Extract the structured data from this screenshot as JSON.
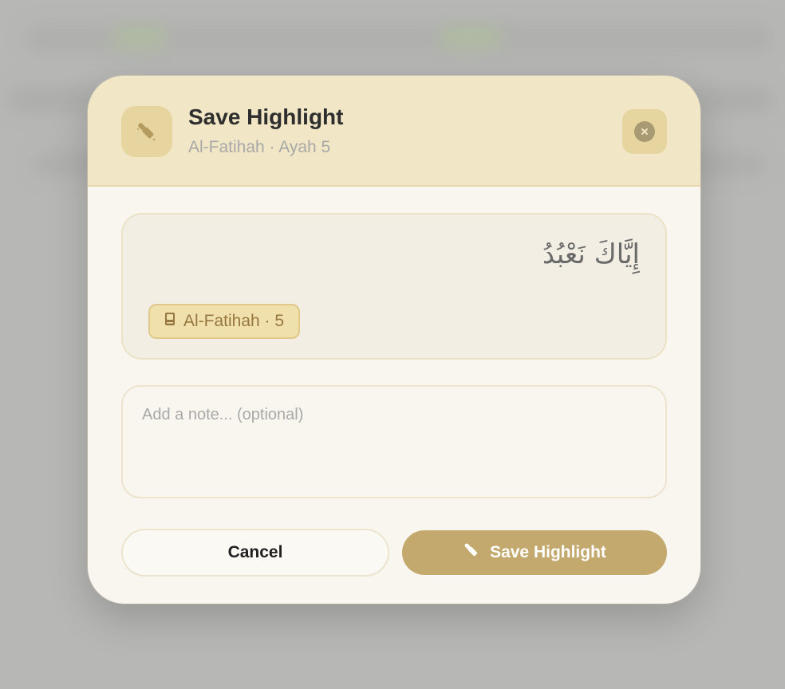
{
  "dialog": {
    "title": "Save Highlight",
    "subtitle": "Al-Fatihah · Ayah 5",
    "header_icon": "highlighter-icon",
    "close_icon": "close-icon"
  },
  "verse": {
    "arabic_text": "إِيَّاكَ نَعْبُدُ",
    "reference_label": "Al-Fatihah · 5",
    "reference_icon": "book-icon"
  },
  "note": {
    "placeholder": "Add a note... (optional)",
    "value": ""
  },
  "actions": {
    "cancel_label": "Cancel",
    "save_label": "Save Highlight",
    "save_icon": "highlighter-icon"
  },
  "colors": {
    "header_bg": "#f1e6c5",
    "accent": "#c4a96e",
    "badge_text": "#98763f",
    "modal_bg": "#f9f6f0"
  }
}
